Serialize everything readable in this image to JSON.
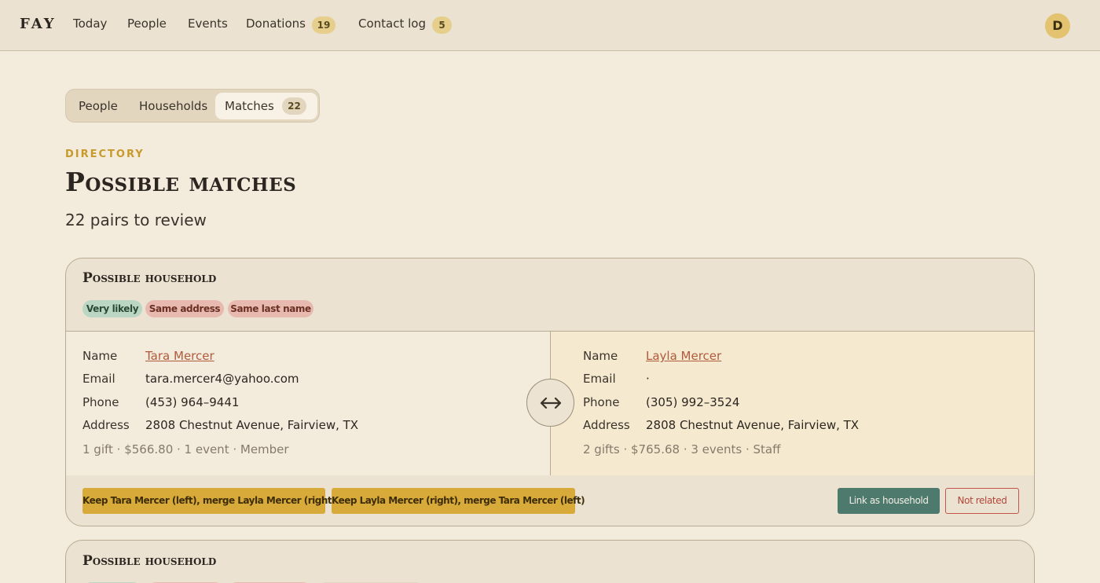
{
  "app": {
    "brand": "FAY",
    "avatar_initial": "D"
  },
  "nav": {
    "items": [
      {
        "label": "Today"
      },
      {
        "label": "People"
      },
      {
        "label": "Events"
      },
      {
        "label": "Donations",
        "count": "19"
      },
      {
        "label": "Contact log",
        "count": "5"
      }
    ]
  },
  "tabs": {
    "items": [
      {
        "label": "People"
      },
      {
        "label": "Households"
      },
      {
        "label": "Matches",
        "count": "22",
        "active": true
      }
    ]
  },
  "header": {
    "eyebrow": "DIRECTORY",
    "title": "Possible matches",
    "subtitle": "22 pairs to review"
  },
  "labels": {
    "name": "Name",
    "email": "Email",
    "phone": "Phone",
    "address": "Address"
  },
  "matches": [
    {
      "title": "Possible household",
      "tags": [
        {
          "label": "Very likely",
          "tone": "green"
        },
        {
          "label": "Same address",
          "tone": "pink"
        },
        {
          "label": "Same last name",
          "tone": "pink"
        }
      ],
      "left": {
        "name": "Tara Mercer",
        "email": "tara.mercer4@yahoo.com",
        "phone": "(453) 964–9441",
        "address": "2808 Chestnut Avenue, Fairview, TX",
        "summary": "1 gift · $566.80 · 1 event · Member"
      },
      "right": {
        "name": "Layla Mercer",
        "email": "·",
        "phone": "(305) 992–3524",
        "address": "2808 Chestnut Avenue, Fairview, TX",
        "summary": "2 gifts · $765.68 · 3 events · Staff"
      },
      "actions": {
        "keep_left": "Keep Tara Mercer (left), merge Layla Mercer (right)",
        "keep_right": "Keep Layla Mercer (right), merge Tara Mercer (left)",
        "link": "Link as household",
        "not_related": "Not related"
      }
    },
    {
      "title": "Possible household"
    }
  ],
  "colors": {
    "background": "#f3ebdc",
    "accent_gold": "#d8aa3a",
    "link_teal": "#4e7a6e",
    "danger": "#c2564a",
    "tag_green": "#bcd6c4",
    "tag_pink": "#e8b9ae"
  },
  "icons": {
    "swap": "arrows-left-right-icon"
  }
}
